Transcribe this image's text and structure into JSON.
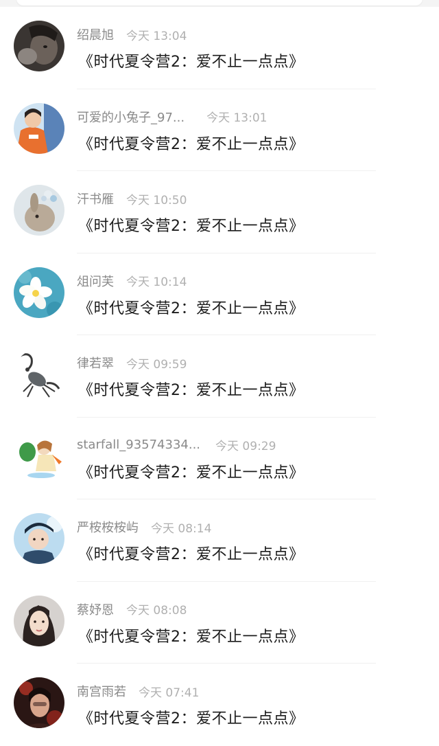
{
  "colors": {
    "username": "#8a8a8a",
    "timestamp": "#b0b0b0",
    "title": "#1c1c1c",
    "divider": "#f0f0f0"
  },
  "messages": [
    {
      "user": "绍晨旭",
      "time": "今天 13:04",
      "title": "《时代夏令营2：爱不止一点点》",
      "avatar_icon": "avatar-dark-portrait"
    },
    {
      "user": "可爱的小兔子_97...",
      "time": "今天 13:01",
      "title": "《时代夏令营2：爱不止一点点》",
      "avatar_icon": "avatar-orange-shirt-boy"
    },
    {
      "user": "汗书雁",
      "time": "今天 10:50",
      "title": "《时代夏令营2：爱不止一点点》",
      "avatar_icon": "avatar-bunny-with-flower"
    },
    {
      "user": "俎问芙",
      "time": "今天 10:14",
      "title": "《时代夏令营2：爱不止一点点》",
      "avatar_icon": "avatar-white-flower-on-water"
    },
    {
      "user": "律若翠",
      "time": "今天 09:59",
      "title": "《时代夏令营2：爱不止一点点》",
      "avatar_icon": "avatar-scorpion-sketch"
    },
    {
      "user": "starfall_93574334...",
      "time": "今天 09:29",
      "title": "《时代夏令营2：爱不止一点点》",
      "avatar_icon": "avatar-cartoon-girl-with-carrot"
    },
    {
      "user": "严桉桉桉屿",
      "time": "今天 08:14",
      "title": "《时代夏令营2：爱不止一点点》",
      "avatar_icon": "avatar-boy-in-cap"
    },
    {
      "user": "蔡妤恩",
      "time": "今天 08:08",
      "title": "《时代夏令营2：爱不止一点点》",
      "avatar_icon": "avatar-woman-portrait"
    },
    {
      "user": "南宫雨若",
      "time": "今天 07:41",
      "title": "《时代夏令营2：爱不止一点点》",
      "avatar_icon": "avatar-red-dark-portrait"
    }
  ]
}
